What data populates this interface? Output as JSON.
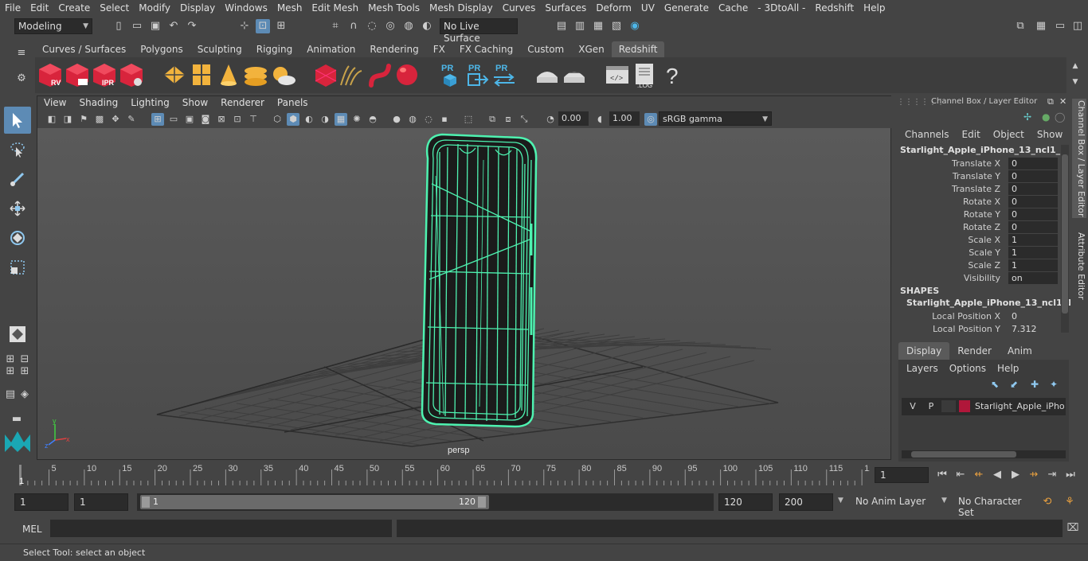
{
  "menubar": {
    "items": [
      "File",
      "Edit",
      "Create",
      "Select",
      "Modify",
      "Display",
      "Windows",
      "Mesh",
      "Edit Mesh",
      "Mesh Tools",
      "Mesh Display",
      "Curves",
      "Surfaces",
      "Deform",
      "UV",
      "Generate",
      "Cache",
      "- 3DtoAll -",
      "Redshift",
      "Help"
    ]
  },
  "toolbar": {
    "mode": "Modeling",
    "live_surface": "No Live Surface"
  },
  "shelf": {
    "tabs": [
      "Curves / Surfaces",
      "Polygons",
      "Sculpting",
      "Rigging",
      "Animation",
      "Rendering",
      "FX",
      "FX Caching",
      "Custom",
      "XGen",
      "Redshift"
    ],
    "active_tab": "Redshift",
    "icon_labels": {
      "rv": "RV",
      "ipr": "IPR",
      "pr": "PR",
      "log": ".LOG",
      "help": "?"
    }
  },
  "viewport": {
    "menu": [
      "View",
      "Shading",
      "Lighting",
      "Show",
      "Renderer",
      "Panels"
    ],
    "exposure": "0.00",
    "gamma": "1.00",
    "color_space": "sRGB gamma",
    "camera_label": "persp",
    "accent": "#5d8bb5",
    "wire_color": "#4ef2b0"
  },
  "channel_box": {
    "title": "Channel Box / Layer Editor",
    "menu": [
      "Channels",
      "Edit",
      "Object",
      "Show"
    ],
    "object_name": "Starlight_Apple_iPhone_13_ncl1_1",
    "attributes": [
      {
        "label": "Translate X",
        "value": "0"
      },
      {
        "label": "Translate Y",
        "value": "0"
      },
      {
        "label": "Translate Z",
        "value": "0"
      },
      {
        "label": "Rotate X",
        "value": "0"
      },
      {
        "label": "Rotate Y",
        "value": "0"
      },
      {
        "label": "Rotate Z",
        "value": "0"
      },
      {
        "label": "Scale X",
        "value": "1"
      },
      {
        "label": "Scale Y",
        "value": "1"
      },
      {
        "label": "Scale Z",
        "value": "1"
      },
      {
        "label": "Visibility",
        "value": "on"
      }
    ],
    "shapes_header": "SHAPES",
    "shape_name": "Starlight_Apple_iPhone_13_ncl1_1...",
    "shape_attrs": [
      {
        "label": "Local Position X",
        "value": "0"
      },
      {
        "label": "Local Position Y",
        "value": "7.312"
      }
    ]
  },
  "layer_editor": {
    "tabs": [
      "Display",
      "Render",
      "Anim"
    ],
    "active_tab": "Display",
    "menu": [
      "Layers",
      "Options",
      "Help"
    ],
    "layer": {
      "v": "V",
      "p": "P",
      "name": "Starlight_Apple_iPhon",
      "color": "#b0173a"
    }
  },
  "side_tabs": [
    "Channel Box / Layer Editor",
    "Attribute Editor"
  ],
  "timeline": {
    "ticks": [
      "5",
      "10",
      "15",
      "20",
      "25",
      "30",
      "35",
      "40",
      "45",
      "50",
      "55",
      "60",
      "65",
      "70",
      "75",
      "80",
      "85",
      "90",
      "95",
      "100",
      "105",
      "110",
      "115",
      "12"
    ],
    "start_marker": "1",
    "current_frame": "1"
  },
  "range": {
    "start": "1",
    "start2": "1",
    "slider_start": "1",
    "slider_end": "120",
    "end": "120",
    "end2": "200",
    "anim_layer": "No Anim Layer",
    "char_set": "No Character Set"
  },
  "cmdline": {
    "label": "MEL"
  },
  "status": {
    "text": "Select Tool: select an object"
  }
}
